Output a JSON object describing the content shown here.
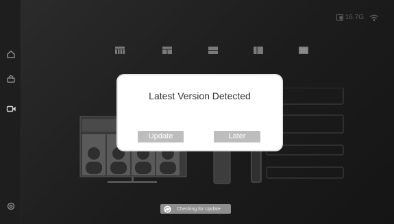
{
  "status_bar": {
    "storage": "16.7G",
    "storage_icon": "storage-icon",
    "wifi_icon": "wifi-icon"
  },
  "sidebar": {
    "icons": [
      "home-icon",
      "bag-icon",
      "video-camera-icon",
      "settings-icon"
    ]
  },
  "layouts": [
    "layout-grid-icon",
    "layout-split-icon",
    "layout-stack-icon",
    "layout-columns-icon",
    "layout-single-icon"
  ],
  "dialog": {
    "title": "Latest Version Detected",
    "update_label": "Update",
    "later_label": "Later"
  },
  "footer": {
    "checking_label": "Checking for Update",
    "refresh_icon": "refresh-icon"
  },
  "colors": {
    "dialog_bg": "#ffffff",
    "button_bg": "#bdbdbd",
    "pill_bg": "#8e8e8e",
    "background": "#222222"
  }
}
